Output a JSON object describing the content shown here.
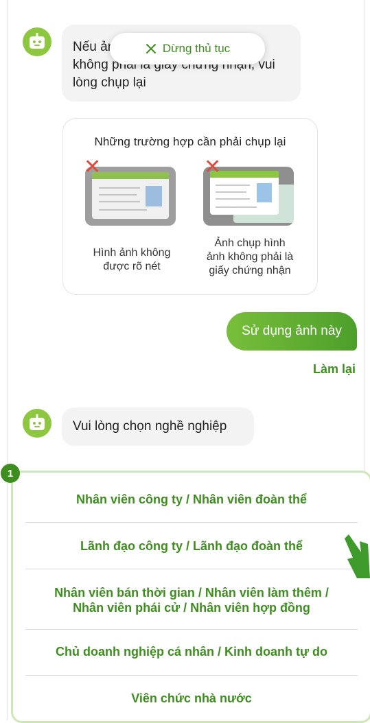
{
  "messages": {
    "first": "Nếu ảnh mờ, hoặc chụp vật khác không phải là giấy chứng nhận, vui lòng chụp lại",
    "second": "Vui lòng chọn nghề nghiệp"
  },
  "stop_button": {
    "label": "Dừng thủ tục",
    "icon": "close-icon"
  },
  "retake_card": {
    "title": "Những trường hợp cần phải chụp lại",
    "items": [
      {
        "label_l1": "Hình ảnh không",
        "label_l2": "được rõ nét",
        "label_l3": ""
      },
      {
        "label_l1": "Ảnh chụp hình",
        "label_l2": "ảnh không phải là",
        "label_l3": "giấy chứng nhận"
      }
    ]
  },
  "user_reply": "Sử dụng ảnh này",
  "retry_link": "Làm lại",
  "step_badge": "1",
  "options": [
    {
      "line1": "Nhân viên công ty / Nhân viên đoàn thể",
      "line2": ""
    },
    {
      "line1": "Lãnh đạo công ty / Lãnh đạo đoàn thể",
      "line2": ""
    },
    {
      "line1": "Nhân viên bán thời gian / Nhân viên làm thêm /",
      "line2": "Nhân viên phái cử / Nhân viên hợp đồng"
    },
    {
      "line1": "Chủ doanh nghiệp cá nhân / Kinh doanh tự do",
      "line2": ""
    },
    {
      "line1": "Viên chức nhà nước",
      "line2": ""
    }
  ],
  "colors": {
    "brand_green": "#3e8e1f",
    "avatar_green": "#8dc63f",
    "bubble_gray": "#f3f3f3"
  }
}
